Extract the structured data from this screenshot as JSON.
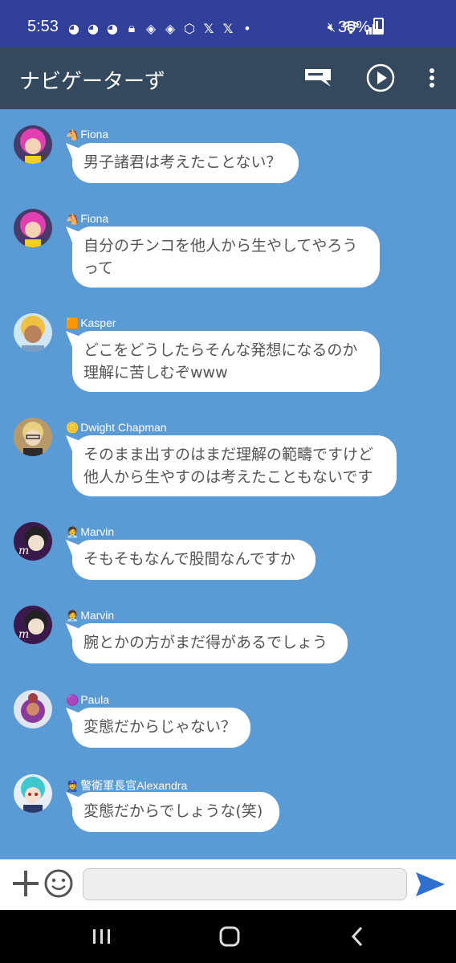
{
  "status": {
    "time": "5:53",
    "battery": "30%",
    "icons": [
      "discord-icon",
      "discord-icon",
      "discord-icon",
      "lock-icon",
      "stack-icon",
      "stack-icon",
      "cube-icon",
      "x-icon",
      "x-icon",
      "dot-icon"
    ]
  },
  "appbar": {
    "title": "ナビゲーターず"
  },
  "messages": [
    {
      "emoji": "🐴",
      "name": "Fiona",
      "text": "男子諸君は考えたことない？"
    },
    {
      "emoji": "🐴",
      "name": "Fiona",
      "text": "自分のチンコを他人から生やしてやろうって"
    },
    {
      "emoji": "🟧",
      "name": "Kasper",
      "text": "どこをどうしたらそんな発想になるのか理解に苦しむぞwww"
    },
    {
      "emoji": "🪙",
      "name": "Dwight Chapman",
      "text": "そのまま出すのはまだ理解の範疇ですけど他人から生やすのは考えたこともないです"
    },
    {
      "emoji": "🧑‍💼",
      "name": "Marvin",
      "text": "そもそもなんで股間なんですか"
    },
    {
      "emoji": "🧑‍💼",
      "name": "Marvin",
      "text": "腕とかの方がまだ得があるでしょう"
    },
    {
      "emoji": "🟣",
      "name": "Paula",
      "text": "変態だからじゃない？"
    },
    {
      "emoji": "👮",
      "name": "警衛軍長官Alexandra",
      "text": "変態だからでしょうな(笑)"
    }
  ],
  "composer": {
    "placeholder": ""
  }
}
